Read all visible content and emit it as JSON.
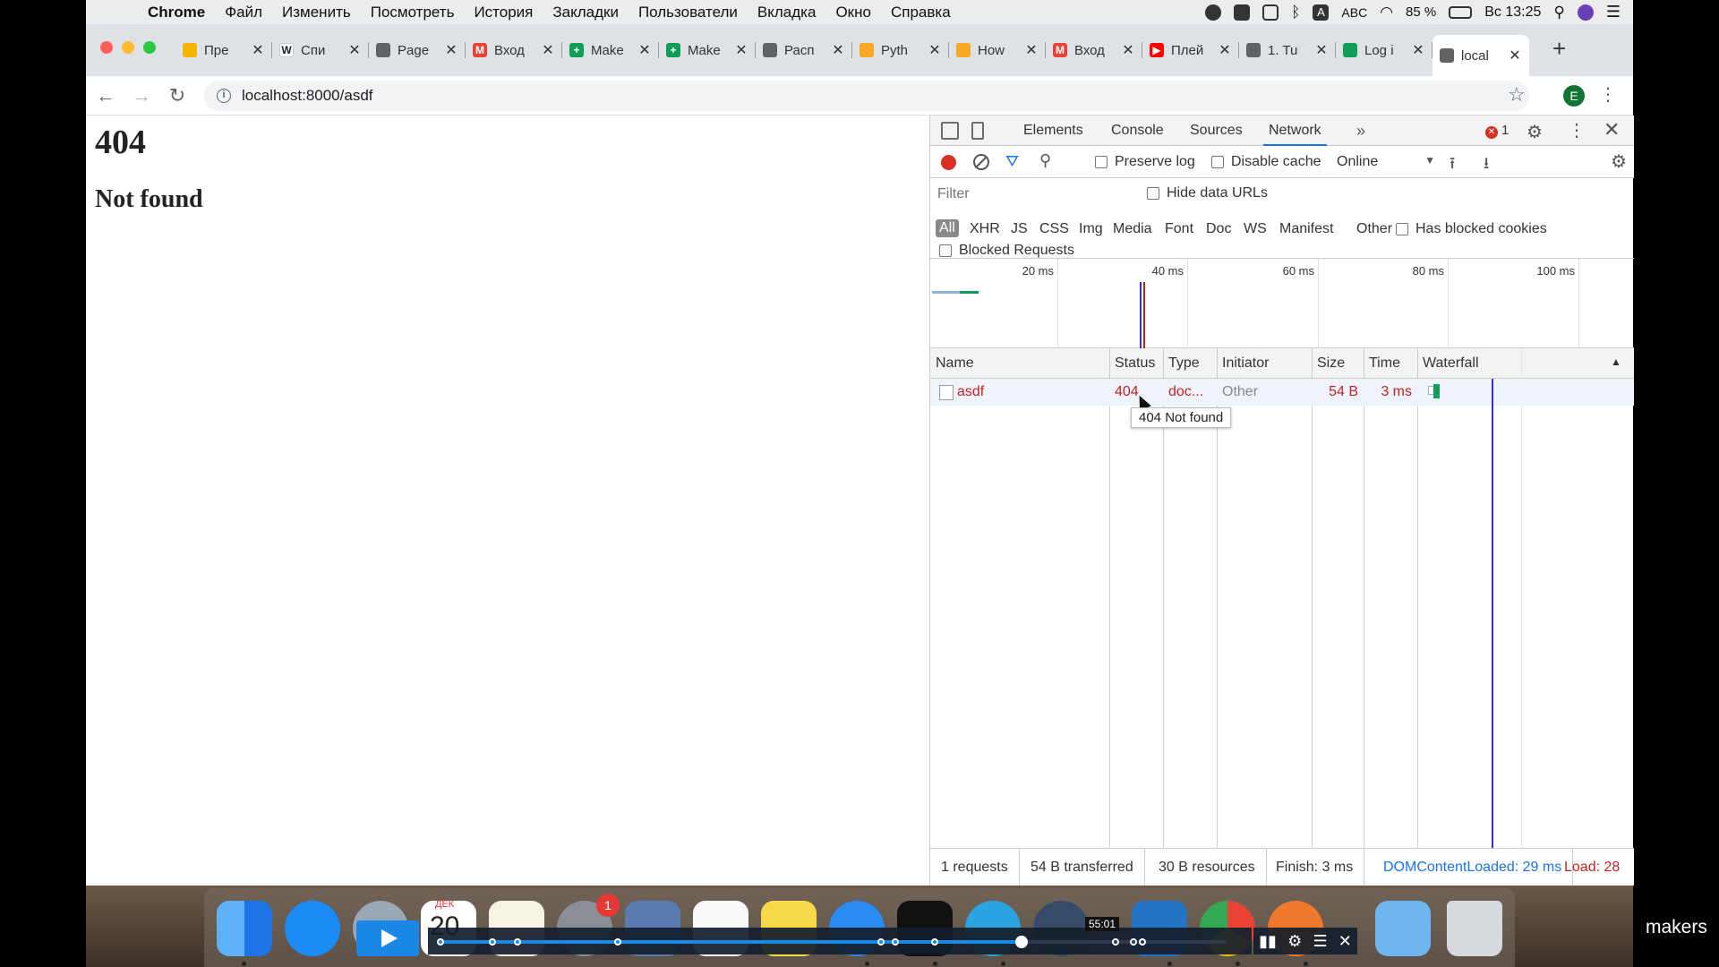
{
  "menubar": {
    "app": "Chrome",
    "items": [
      "Файл",
      "Изменить",
      "Посмотреть",
      "История",
      "Закладки",
      "Пользователи",
      "Вкладка",
      "Окно",
      "Справка"
    ],
    "input_source": "ABC",
    "battery": "85 %",
    "clock": "Вс 13:25"
  },
  "tabs": [
    {
      "label": "Пре",
      "fav_color": "#f4b400",
      "fav": ""
    },
    {
      "label": "Спи",
      "fav_color": "#ffffff",
      "fav": "W"
    },
    {
      "label": "Page",
      "fav_color": "#5f6368",
      "fav": ""
    },
    {
      "label": "Вход",
      "fav_color": "#ea4335",
      "fav": "M"
    },
    {
      "label": "Make",
      "fav_color": "#0f9d58",
      "fav": "+"
    },
    {
      "label": "Make",
      "fav_color": "#0f9d58",
      "fav": "+"
    },
    {
      "label": "Расп",
      "fav_color": "#5f6368",
      "fav": ""
    },
    {
      "label": "Pyth",
      "fav_color": "#f9a825",
      "fav": ""
    },
    {
      "label": "How",
      "fav_color": "#f9a825",
      "fav": ""
    },
    {
      "label": "Вход",
      "fav_color": "#ea4335",
      "fav": "M"
    },
    {
      "label": "Плей",
      "fav_color": "#ff0000",
      "fav": "▶"
    },
    {
      "label": "1. Tu",
      "fav_color": "#5f6368",
      "fav": ""
    },
    {
      "label": "Log i",
      "fav_color": "#0f9d58",
      "fav": ""
    },
    {
      "label": "local",
      "fav_color": "#5f6368",
      "fav": ""
    }
  ],
  "address": {
    "url": "localhost:8000/asdf"
  },
  "profile": {
    "initial": "E"
  },
  "page": {
    "heading": "404",
    "subheading": "Not found"
  },
  "devtools": {
    "tabs": [
      "Elements",
      "Console",
      "Sources",
      "Network"
    ],
    "active_tab": "Network",
    "more": "»",
    "error_count": "1",
    "toolbar": {
      "preserve_log": "Preserve log",
      "disable_cache": "Disable cache",
      "throttling": "Online"
    },
    "filter": {
      "placeholder": "Filter",
      "hide_data_urls": "Hide data URLs",
      "types": [
        "All",
        "XHR",
        "JS",
        "CSS",
        "Img",
        "Media",
        "Font",
        "Doc",
        "WS",
        "Manifest",
        "Other"
      ],
      "has_blocked_cookies": "Has blocked cookies",
      "blocked_requests": "Blocked Requests"
    },
    "overview": {
      "ticks": [
        "20 ms",
        "40 ms",
        "60 ms",
        "80 ms",
        "100 ms"
      ]
    },
    "columns": [
      "Name",
      "Status",
      "Type",
      "Initiator",
      "Size",
      "Time",
      "Waterfall"
    ],
    "request": {
      "name": "asdf",
      "status": "404",
      "type": "doc...",
      "initiator": "Other",
      "size": "54 B",
      "time": "3 ms"
    },
    "tooltip": "404 Not found",
    "status_bar": {
      "requests": "1 requests",
      "transferred": "54 B transferred",
      "resources": "30 B resources",
      "finish": "Finish: 3 ms",
      "dcl": "DOMContentLoaded: 29 ms",
      "load": "Load: 28"
    }
  },
  "dock": {
    "badge": "1",
    "calendar_month": "ДЕК",
    "calendar_day": "20"
  },
  "player": {
    "time": "55:01",
    "progress": 0.74
  },
  "watermark": "makers"
}
